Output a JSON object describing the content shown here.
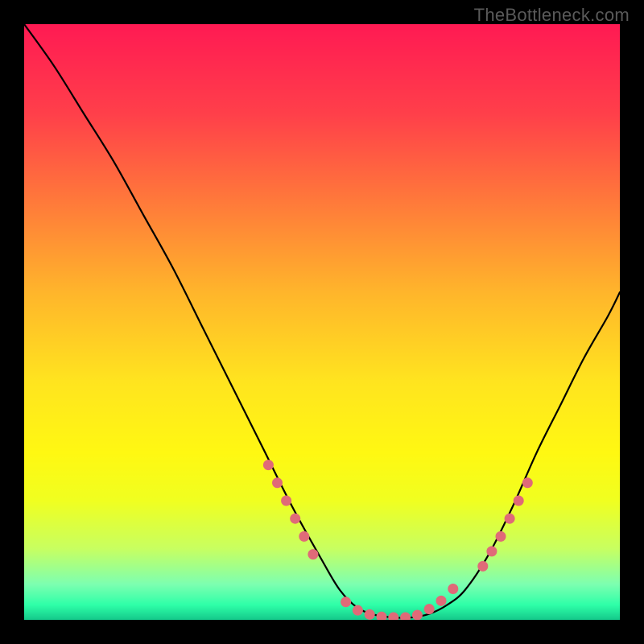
{
  "watermark": "TheBottleneck.com",
  "chart_data": {
    "type": "line",
    "title": "",
    "xlabel": "",
    "ylabel": "",
    "xlim": [
      0,
      100
    ],
    "ylim": [
      0,
      100
    ],
    "grid": false,
    "legend": false,
    "background_gradient": {
      "stops": [
        {
          "offset": 0.0,
          "color": "#ff1a53"
        },
        {
          "offset": 0.15,
          "color": "#ff3f4a"
        },
        {
          "offset": 0.3,
          "color": "#ff7a3a"
        },
        {
          "offset": 0.45,
          "color": "#ffb52b"
        },
        {
          "offset": 0.6,
          "color": "#ffe41f"
        },
        {
          "offset": 0.72,
          "color": "#fff812"
        },
        {
          "offset": 0.8,
          "color": "#f0ff20"
        },
        {
          "offset": 0.88,
          "color": "#c8ff60"
        },
        {
          "offset": 0.94,
          "color": "#7dffb0"
        },
        {
          "offset": 0.975,
          "color": "#2effa8"
        },
        {
          "offset": 1.0,
          "color": "#14c98a"
        }
      ]
    },
    "series": [
      {
        "name": "curve",
        "type": "line",
        "color": "#000000",
        "x": [
          0,
          5,
          10,
          15,
          20,
          25,
          30,
          35,
          40,
          45,
          50,
          53,
          56,
          59,
          62,
          65,
          68,
          71,
          74,
          78,
          82,
          86,
          90,
          94,
          98,
          100
        ],
        "y": [
          100,
          93,
          85,
          77,
          68,
          59,
          49,
          39,
          29,
          19,
          10,
          5,
          2,
          0.8,
          0.4,
          0.4,
          1.0,
          2.5,
          5,
          11,
          19,
          28,
          36,
          44,
          51,
          55
        ]
      },
      {
        "name": "left-cluster-markers",
        "type": "scatter",
        "color": "#e06a78",
        "x": [
          41,
          42.5,
          44,
          45.5,
          47,
          48.5
        ],
        "y": [
          26,
          23,
          20,
          17,
          14,
          11
        ]
      },
      {
        "name": "valley-markers",
        "type": "scatter",
        "color": "#e06a78",
        "x": [
          54,
          56,
          58,
          60,
          62,
          64,
          66,
          68,
          70,
          72
        ],
        "y": [
          3.0,
          1.6,
          0.9,
          0.5,
          0.4,
          0.4,
          0.8,
          1.8,
          3.2,
          5.2
        ]
      },
      {
        "name": "right-cluster-markers",
        "type": "scatter",
        "color": "#e06a78",
        "x": [
          77,
          78.5,
          80,
          81.5,
          83,
          84.5
        ],
        "y": [
          9.0,
          11.5,
          14,
          17,
          20,
          23
        ]
      }
    ]
  }
}
